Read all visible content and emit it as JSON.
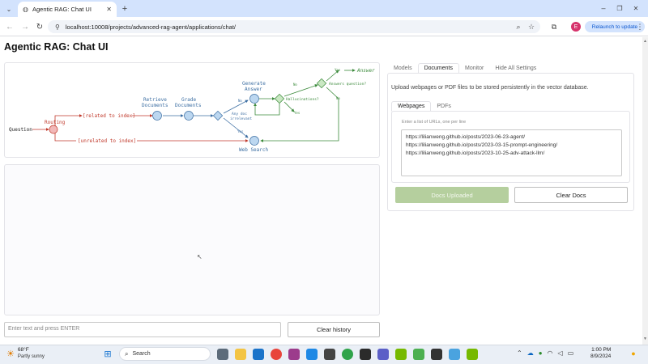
{
  "browser": {
    "tab_title": "Agentic RAG: Chat UI",
    "url": "localhost:10008/projects/advanced-rag-agent/applications/chat/",
    "relaunch_label": "Relaunch to update",
    "profile_initial": "E"
  },
  "page": {
    "title": "Agentic RAG: Chat UI"
  },
  "diagram": {
    "question": "Question",
    "routing": "Routing",
    "related": "[related to index]",
    "unrelated": "[unrelated to index]",
    "retrieve": "Retrieve",
    "retrieve2": "Documents",
    "grade": "Grade",
    "grade2": "Documents",
    "generate": "Generate",
    "generate2": "Answer",
    "any_doc": "Any doc",
    "irrelevant": "irrelevant",
    "no": "No",
    "yes": "Yes",
    "hallucinations": "Hallucinations?",
    "answers_question": "Answers question?",
    "answer": "Answer",
    "web_search": "Web Search"
  },
  "chat": {
    "input_placeholder": "Enter text and press ENTER",
    "clear_history": "Clear history"
  },
  "settings": {
    "tabs": [
      "Models",
      "Documents",
      "Monitor",
      "Hide All Settings"
    ],
    "active_tab": "Documents",
    "description": "Upload webpages or PDF files to be stored persistently in the vector database.",
    "subtabs": [
      "Webpages",
      "PDFs"
    ],
    "active_subtab": "Webpages",
    "urls_label": "Enter a list of URLs, one per line",
    "urls": [
      "https://lilianweng.github.io/posts/2023-06-23-agent/",
      "https://lilianweng.github.io/posts/2023-03-15-prompt-engineering/",
      "https://lilianweng.github.io/posts/2023-10-25-adv-attack-llm/"
    ],
    "docs_uploaded": "Docs Uploaded",
    "clear_docs": "Clear Docs"
  },
  "taskbar": {
    "weather_temp": "68°F",
    "weather_desc": "Partly sunny",
    "search": "Search",
    "time": "1:00 PM",
    "date": "8/9/2024"
  },
  "colors": {
    "accent_green": "#b5cf9e",
    "tab_strip": "#d3e3fd",
    "diagram_blue": "#3d6fa3",
    "diagram_red": "#c0392b",
    "diagram_green": "#3b8a3b"
  }
}
